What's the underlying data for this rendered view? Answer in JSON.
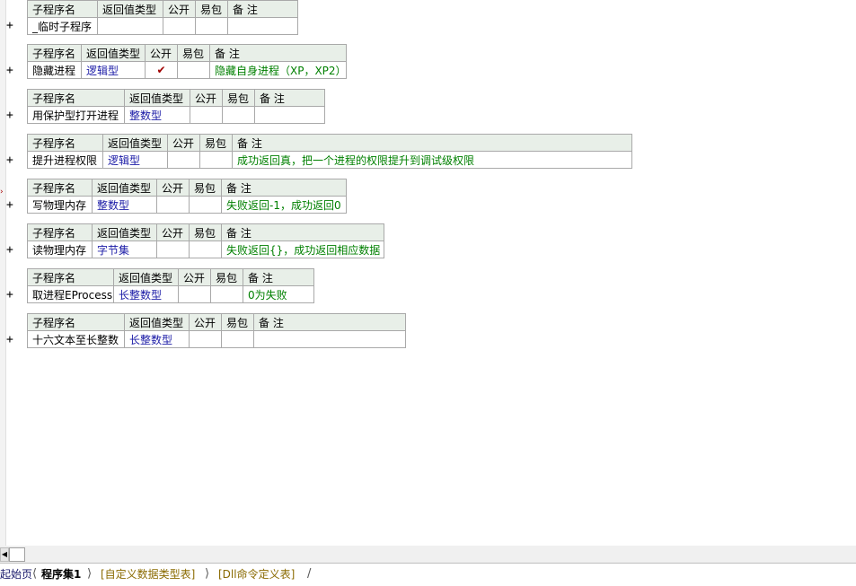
{
  "headers": {
    "name": "子程序名",
    "return_type": "返回值类型",
    "public": "公开",
    "easy_pack": "易包",
    "note": "备 注"
  },
  "procedures": [
    {
      "name": "_临时子程序",
      "type": "",
      "public": "",
      "easy": "",
      "note": ""
    },
    {
      "name": "隐藏进程",
      "type": "逻辑型",
      "public": "✔",
      "easy": "",
      "note": "隐藏自身进程（XP，XP2）"
    },
    {
      "name": "用保护型打开进程",
      "type": "整数型",
      "public": "",
      "easy": "",
      "note": ""
    },
    {
      "name": "提升进程权限",
      "type": "逻辑型",
      "public": "",
      "easy": "",
      "note": "成功返回真，把一个进程的权限提升到调试级权限"
    },
    {
      "name": "写物理内存",
      "type": "整数型",
      "public": "",
      "easy": "",
      "note": "失败返回-1，成功返回0"
    },
    {
      "name": "读物理内存",
      "type": "字节集",
      "public": "",
      "easy": "",
      "note": "失败返回{}，成功返回相应数据"
    },
    {
      "name": "取进程EProcess",
      "type": "长整数型",
      "public": "",
      "easy": "",
      "note": "0为失败"
    },
    {
      "name": "十六文本至长整数",
      "type": "长整数型",
      "public": "",
      "easy": "",
      "note": ""
    }
  ],
  "expand_symbol": "+",
  "tabs": {
    "start": "起始页",
    "program_set": "程序集1",
    "custom_types": "[自定义数据类型表]",
    "dll_commands": "[Dll命令定义表]"
  }
}
